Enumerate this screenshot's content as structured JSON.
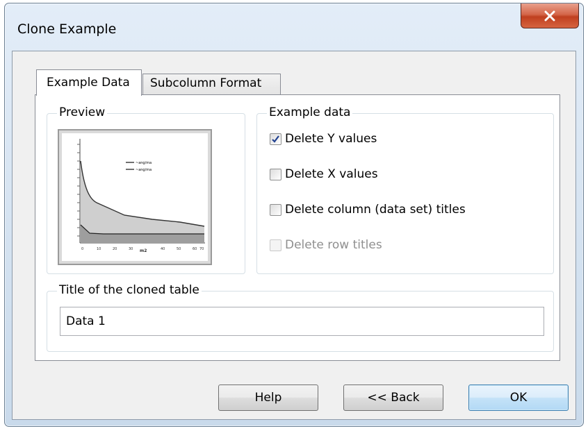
{
  "window": {
    "title": "Clone Example"
  },
  "tabs": [
    {
      "label": "Example Data",
      "active": true
    },
    {
      "label": "Subcolumn Format",
      "active": false
    }
  ],
  "preview": {
    "label": "Preview",
    "legend": [
      "~ang/ma",
      "~ang/ma"
    ],
    "x_ticks": [
      "0",
      "10",
      "20",
      "30",
      "40",
      "50",
      "60",
      "70"
    ],
    "x_label": "m2"
  },
  "example_data": {
    "label": "Example data",
    "options": [
      {
        "label": "Delete Y values",
        "checked": true,
        "enabled": true
      },
      {
        "label": "Delete X values",
        "checked": false,
        "enabled": true
      },
      {
        "label": "Delete column (data set) titles",
        "checked": false,
        "enabled": true
      },
      {
        "label": "Delete row titles",
        "checked": false,
        "enabled": false
      }
    ]
  },
  "cloned_title": {
    "label": "Title of the cloned table",
    "value": "Data 1"
  },
  "buttons": {
    "help": "Help",
    "back": "<< Back",
    "ok": "OK"
  },
  "colors": {
    "accent": "#3c7fb1",
    "close": "#c0401f"
  }
}
